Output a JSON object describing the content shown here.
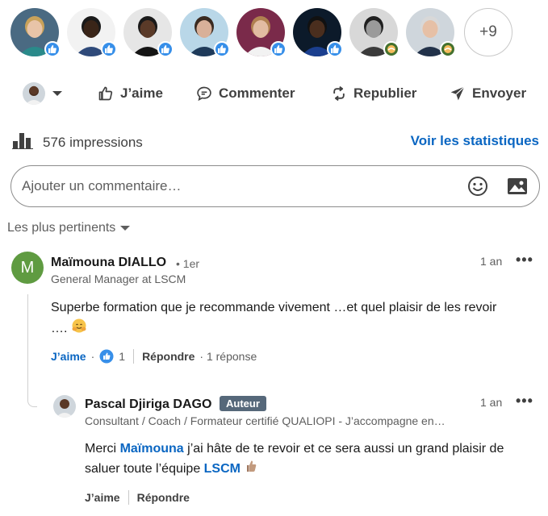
{
  "reactors": {
    "avatars": [
      {
        "name": "reactor-1",
        "reaction": "like",
        "bg": "#4a6a82",
        "skin": "#e8c4a8",
        "hair": "#c9a25a",
        "shirt": "#2a8a8a"
      },
      {
        "name": "reactor-2",
        "reaction": "like",
        "bg": "#f2f2f2",
        "skin": "#3a2518",
        "hair": "#1a1a1a",
        "shirt": "#2f4a7a"
      },
      {
        "name": "reactor-3",
        "reaction": "like",
        "bg": "#e6e6e6",
        "skin": "#5a3a28",
        "hair": "#1a1a1a",
        "shirt": "#141414"
      },
      {
        "name": "reactor-4",
        "reaction": "like",
        "bg": "#b9d7e8",
        "skin": "#d8b099",
        "hair": "#3a2a20",
        "shirt": "#1e3a5a"
      },
      {
        "name": "reactor-5",
        "reaction": "like",
        "bg": "#7a2a4a",
        "skin": "#e2bca2",
        "hair": "#b08050",
        "shirt": "#f2f2f2"
      },
      {
        "name": "reactor-6",
        "reaction": "like",
        "bg": "#0c1a2a",
        "skin": "#4a2e1e",
        "hair": "#111111",
        "shirt": "#1b3f8f"
      },
      {
        "name": "reactor-7",
        "reaction": "support",
        "bg": "#d8d8d8",
        "skin": "#9a9a9a",
        "hair": "#202020",
        "shirt": "#3a3a3a"
      },
      {
        "name": "reactor-8",
        "reaction": "support",
        "bg": "#cfd6dc",
        "skin": "#e6c0a6",
        "hair": "#d8d8d8",
        "shirt": "#22324a"
      }
    ],
    "more_label": "+9"
  },
  "actions": {
    "like": "J’aime",
    "comment": "Commenter",
    "repost": "Republier",
    "send": "Envoyer"
  },
  "impressions": {
    "label": "576 impressions",
    "stats_link": "Voir les statistiques"
  },
  "comment_box": {
    "placeholder": "Ajouter un commentaire…"
  },
  "sort": {
    "label": "Les plus pertinents"
  },
  "comments": [
    {
      "initial": "M",
      "author": "Maïmouna DIALLO",
      "degree": "• 1er",
      "headline": "General Manager at LSCM",
      "time": "1 an",
      "text_line1": "Superbe formation que je recommande vivement …et quel plaisir de les revoir",
      "text_line2": "….",
      "like_label": "J’aime",
      "like_count": "1",
      "reply_label": "Répondre",
      "reply_count": "· 1 réponse",
      "avatar_color": "#5f9b41"
    }
  ],
  "reply": {
    "author": "Pascal Djiriga DAGO",
    "badge": "Auteur",
    "headline": "Consultant / Coach / Formateur certifié QUALIOPI - J’accompagne en…",
    "time": "1 an",
    "text_pre": "Merci ",
    "mention1": "Maïmouna",
    "text_mid": " j’ai hâte de te revoir et ce sera aussi un grand plaisir de",
    "text_line2_pre": "saluer toute l’équipe ",
    "mention2": "LSCM",
    "like_label": "J’aime",
    "reply_label": "Répondre"
  },
  "colors": {
    "accent": "#0a66c2",
    "text": "#191919",
    "muted": "#5e5e5e"
  }
}
